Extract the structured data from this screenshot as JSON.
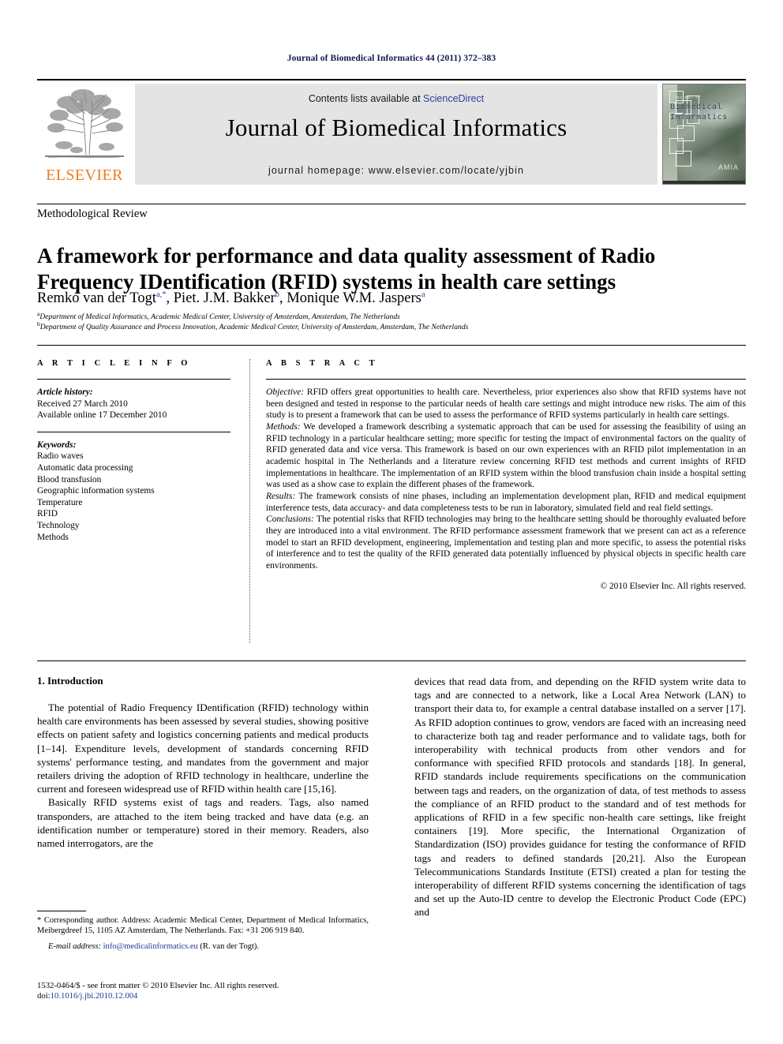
{
  "running_head": "Journal of Biomedical Informatics 44 (2011) 372–383",
  "masthead": {
    "contents_prefix": "Contents lists available at ",
    "sciencedirect_link": "ScienceDirect",
    "journal_title": "Journal of Biomedical Informatics",
    "homepage": "journal homepage: www.elsevier.com/locate/yjbin",
    "publisher_wordmark": "ELSEVIER",
    "publisher_color": "#ef7c1b",
    "link_color": "#2b3f9e",
    "cover": {
      "small_label": "Journal of",
      "title_line1": "Biomedical",
      "title_line2": "Informatics",
      "society_mark": "AMIA"
    }
  },
  "article": {
    "type": "Methodological Review",
    "title": "A framework for performance and data quality assessment of Radio Frequency IDentification (RFID) systems in health care settings",
    "authors_html": "Remko van der Togt<sup>a,*</sup>, Piet. J.M. Bakker<sup>b</sup>, Monique W.M. Jaspers<sup>a</sup>",
    "affiliations": [
      {
        "marker": "a",
        "text": "Department of Medical Informatics, Academic Medical Center, University of Amsterdam, Amsterdam, The Netherlands"
      },
      {
        "marker": "b",
        "text": "Department of Quality Assurance and Process Innovation, Academic Medical Center, University of Amsterdam, Amsterdam, The Netherlands"
      }
    ]
  },
  "info": {
    "heading": "A R T I C L E   I N F O",
    "history_label": "Article history:",
    "history": [
      "Received 27 March 2010",
      "Available online 17 December 2010"
    ],
    "keywords_label": "Keywords:",
    "keywords": [
      "Radio waves",
      "Automatic data processing",
      "Blood transfusion",
      "Geographic information systems",
      "Temperature",
      "RFID",
      "Technology",
      "Methods"
    ]
  },
  "abstract": {
    "heading": "A B S T R A C T",
    "sections": [
      {
        "label": "Objective:",
        "text": " RFID offers great opportunities to health care. Nevertheless, prior experiences also show that RFID systems have not been designed and tested in response to the particular needs of health care settings and might introduce new risks. The aim of this study is to present a framework that can be used to assess the performance of RFID systems particularly in health care settings."
      },
      {
        "label": "Methods:",
        "text": " We developed a framework describing a systematic approach that can be used for assessing the feasibility of using an RFID technology in a particular healthcare setting; more specific for testing the impact of environmental factors on the quality of RFID generated data and vice versa. This framework is based on our own experiences with an RFID pilot implementation in an academic hospital in The Netherlands and a literature review concerning RFID test methods and current insights of RFID implementations in healthcare. The implementation of an RFID system within the blood transfusion chain inside a hospital setting was used as a show case to explain the different phases of the framework."
      },
      {
        "label": "Results:",
        "text": " The framework consists of nine phases, including an implementation development plan, RFID and medical equipment interference tests, data accuracy- and data completeness tests to be run in laboratory, simulated field and real field settings."
      },
      {
        "label": "Conclusions:",
        "text": " The potential risks that RFID technologies may bring to the healthcare setting should be thoroughly evaluated before they are introduced into a vital environment. The RFID performance assessment framework that we present can act as a reference model to start an RFID development, engineering, implementation and testing plan and more specific, to assess the potential risks of interference and to test the quality of the RFID generated data potentially influenced by physical objects in specific health care environments."
      }
    ],
    "copyright": "© 2010 Elsevier Inc. All rights reserved."
  },
  "body": {
    "section_number_title": "1. Introduction",
    "left_paragraphs": [
      "The potential of Radio Frequency IDentification (RFID) technology within health care environments has been assessed by several studies, showing positive effects on patient safety and logistics concerning patients and medical products [1–14]. Expenditure levels, development of standards concerning RFID systems' performance testing, and mandates from the government and major retailers driving the adoption of RFID technology in healthcare, underline the current and foreseen widespread use of RFID within health care [15,16].",
      "Basically RFID systems exist of tags and readers. Tags, also named transponders, are attached to the item being tracked and have data (e.g. an identification number or temperature) stored in their memory. Readers, also named interrogators, are the"
    ],
    "right_paragraphs": [
      "devices that read data from, and depending on the RFID system write data to tags and are connected to a network, like a Local Area Network (LAN) to transport their data to, for example a central database installed on a server [17]. As RFID adoption continues to grow, vendors are faced with an increasing need to characterize both tag and reader performance and to validate tags, both for interoperability with technical products from other vendors and for conformance with specified RFID protocols and standards [18]. In general, RFID standards include requirements specifications on the communication between tags and readers, on the organization of data, of test methods to assess the compliance of an RFID product to the standard and of test methods for applications of RFID in a few specific non-health care settings, like freight containers [19]. More specific, the International Organization of Standardization (ISO) provides guidance for testing the conformance of RFID tags and readers to defined standards [20,21]. Also the European Telecommunications Standards Institute (ETSI) created a plan for testing the interoperability of different RFID systems concerning the identification of tags and set up the Auto-ID centre to develop the Electronic Product Code (EPC) and"
    ]
  },
  "footnote": {
    "corresponding": "* Corresponding author. Address: Academic Medical Center, Department of Medical Informatics, Meibergdreef 15, 1105 AZ Amsterdam, The Netherlands. Fax: +31 206 919 840.",
    "email_label": "E-mail address:",
    "email_address": "info@medicalinformatics.eu",
    "email_suffix": " (R. van der Togt)."
  },
  "imprint": {
    "issn_line": "1532-0464/$ - see front matter © 2010 Elsevier Inc. All rights reserved.",
    "doi_prefix": "doi:",
    "doi": "10.1016/j.jbi.2010.12.004"
  }
}
